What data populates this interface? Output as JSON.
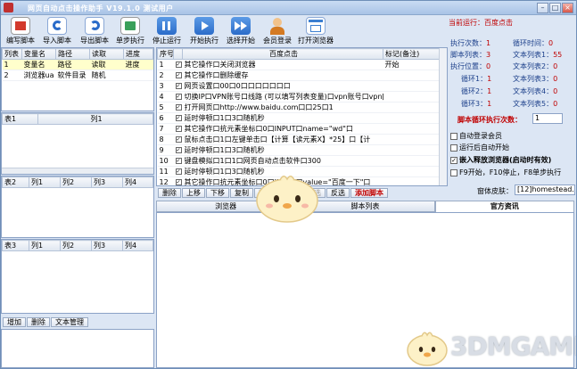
{
  "window": {
    "title": "网页自动点击操作助手 V19.1.0   测试用户"
  },
  "toolbar": [
    {
      "label": "编写脚本",
      "icon": "edit-script-icon",
      "color": "#d33a2c"
    },
    {
      "label": "导入脚本",
      "icon": "import-script-icon",
      "color": "#2b6cc9"
    },
    {
      "label": "导出脚本",
      "icon": "export-script-icon",
      "color": "#2b6cc9"
    },
    {
      "label": "单步执行",
      "icon": "step-run-icon",
      "color": "#3aa05a"
    },
    {
      "label": "停止运行",
      "icon": "pause-icon",
      "color": "#2b6cc9"
    },
    {
      "label": "开始执行",
      "icon": "play-icon",
      "color": "#2b6cc9"
    },
    {
      "label": "选择开始",
      "icon": "fast-forward-icon",
      "color": "#2b6cc9"
    },
    {
      "label": "会员登录",
      "icon": "member-login-icon",
      "color": "#d47a22"
    },
    {
      "label": "打开浏览器",
      "icon": "browser-icon",
      "color": "#3b7fd1"
    }
  ],
  "status": {
    "current_label": "当前运行：",
    "current_value": "百度点击"
  },
  "left_table": {
    "headers": [
      "列表",
      "变量名",
      "路径",
      "读取",
      "进度"
    ],
    "rows": [
      [
        "1",
        "变量名",
        "路径",
        "读取",
        "进度"
      ],
      [
        "2",
        "浏览器ua",
        "软件目录",
        "随机",
        ""
      ]
    ]
  },
  "table1": {
    "headers": [
      "表1",
      "列1"
    ]
  },
  "table2": {
    "headers": [
      "表2",
      "列1",
      "列2",
      "列3",
      "列4"
    ]
  },
  "table3": {
    "headers": [
      "表3",
      "列1",
      "列2",
      "列3",
      "列4"
    ]
  },
  "bottom_left_buttons": [
    "增加",
    "删除",
    "文本管理"
  ],
  "script": {
    "headers": [
      "序号",
      "",
      "百度点击",
      "标记(备注)"
    ],
    "rows": [
      {
        "n": "1",
        "text": "其它操作口关闭浏览器",
        "mark": "开始"
      },
      {
        "n": "2",
        "text": "其它操作口删除缓存",
        "mark": ""
      },
      {
        "n": "3",
        "text": "网页设置口00口0口口口口口口口",
        "mark": ""
      },
      {
        "n": "4",
        "text": "切换IP口VPN账号口线路 (可以填写列表变量)口vpn账号口vpn[",
        "mark": ""
      },
      {
        "n": "5",
        "text": "打开网页口http://www.baidu.com口口25口1",
        "mark": ""
      },
      {
        "n": "6",
        "text": "延时停顿口1口3口随机秒",
        "mark": ""
      },
      {
        "n": "7",
        "text": "其它操作口抗元素坐标口0口INPUT口name=\"wd\"口",
        "mark": ""
      },
      {
        "n": "8",
        "text": "鼠标点击口1口左键单击口【计算【读元素X】*25】口【计",
        "mark": ""
      },
      {
        "n": "9",
        "text": "延时停顿口1口3口随机秒",
        "mark": ""
      },
      {
        "n": "10",
        "text": "键盘模拟口1口1口网页自动点击软件口300",
        "mark": ""
      },
      {
        "n": "11",
        "text": "延时停顿口1口3口随机秒",
        "mark": ""
      },
      {
        "n": "12",
        "text": "其它操作口抗元素坐标口0口INPUT口value=\"百度一下\"口",
        "mark": ""
      },
      {
        "n": "13",
        "text": "鼠标点击口1口左键单击口【计算【读元素X】*25】口【计",
        "mark": ""
      },
      {
        "n": "14",
        "text": "延时停顿口6口9口随机秒",
        "mark": ""
      }
    ]
  },
  "edit_buttons": [
    "删除",
    "上移",
    "下移",
    "复制",
    "粘贴",
    "修改",
    "全选",
    "反选",
    "添加脚本"
  ],
  "info": {
    "exec_count_label": "执行次数：",
    "exec_count": "1",
    "cycle_label": "循环时间：",
    "cycle": "0",
    "script_list_label": "脚本列表：",
    "script_list": "3",
    "text_list1_label": "文本列表1：",
    "text_list1": "55",
    "exec_pos_label": "执行位置：",
    "exec_pos": "0",
    "text_list2_label": "文本列表2：",
    "text_list2": "0",
    "loop1_label": "循环1：",
    "loop1": "1",
    "text_list3_label": "文本列表3：",
    "text_list3": "0",
    "loop2_label": "循环2：",
    "loop2": "1",
    "text_list4_label": "文本列表4：",
    "text_list4": "0",
    "loop3_label": "循环3：",
    "loop3": "1",
    "text_list5_label": "文本列表5：",
    "text_list5": "0",
    "loop_count_label": "脚本循环执行次数：",
    "loop_count": "1",
    "opt1": "自动登录会员",
    "opt2": "运行后自动开始",
    "opt3": "嵌入释放浏览器(启动时有效)",
    "opt4": "F9开始，F10停止，F8单步执行",
    "skin_label": "窗体皮肤：",
    "skin_value": "[12]homestead.she"
  },
  "tabs": [
    "浏览器",
    "脚本列表",
    "官方资讯"
  ],
  "watermark": "3DMGAME"
}
